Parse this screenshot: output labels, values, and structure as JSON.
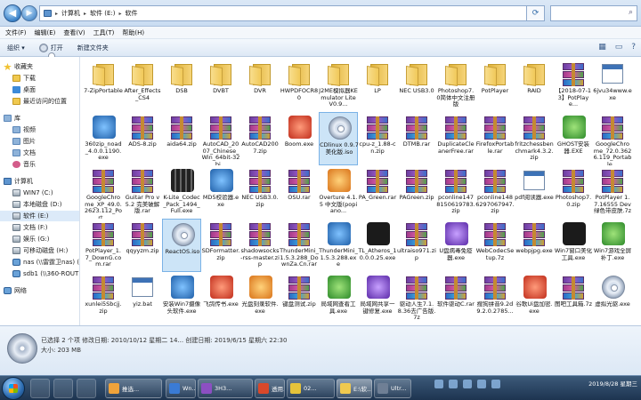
{
  "address": {
    "crumbs": [
      "计算机",
      "软件 (E:)",
      "软件"
    ],
    "separator": "▸"
  },
  "menubar": [
    "文件(F)",
    "编辑(E)",
    "查看(V)",
    "工具(T)",
    "帮助(H)"
  ],
  "toolbar": {
    "organize": "组织 ▾",
    "open": "打开",
    "new_folder": "新建文件夹"
  },
  "nav": [
    {
      "label": "收藏夹",
      "icon": "star-icon",
      "indent": 0
    },
    {
      "label": "下载",
      "icon": "folder-icon",
      "indent": 1
    },
    {
      "label": "桌面",
      "icon": "desktop-icon",
      "indent": 1
    },
    {
      "label": "最近访问的位置",
      "icon": "recent-icon",
      "indent": 1
    },
    {
      "label": "库",
      "icon": "library-icon",
      "indent": 0
    },
    {
      "label": "视频",
      "icon": "video-icon",
      "indent": 1
    },
    {
      "label": "图片",
      "icon": "pictures-icon",
      "indent": 1
    },
    {
      "label": "文档",
      "icon": "documents-icon",
      "indent": 1
    },
    {
      "label": "音乐",
      "icon": "music-icon",
      "indent": 1
    },
    {
      "label": "计算机",
      "icon": "computer-icon",
      "indent": 0
    },
    {
      "label": "WIN7 (C:)",
      "icon": "drive-icon",
      "indent": 1
    },
    {
      "label": "本地磁盘 (D:)",
      "icon": "drive-icon",
      "indent": 1
    },
    {
      "label": "软件 (E:)",
      "icon": "drive-icon",
      "indent": 1,
      "selected": true
    },
    {
      "label": "文档 (F:)",
      "icon": "drive-icon",
      "indent": 1
    },
    {
      "label": "娱乐 (G:)",
      "icon": "drive-icon",
      "indent": 1
    },
    {
      "label": "可移动磁盘 (H:)",
      "icon": "drive-icon",
      "indent": 1
    },
    {
      "label": "nas (\\\\雷霆卫nas) (Y:",
      "icon": "network-drive-icon",
      "indent": 1
    },
    {
      "label": "sdb1 (\\\\360-ROUT",
      "icon": "network-drive-icon",
      "indent": 1
    },
    {
      "label": "网络",
      "icon": "network-icon",
      "indent": 0
    }
  ],
  "files": [
    {
      "name": "7-ZipPortable",
      "type": "folder"
    },
    {
      "name": "After_Effects_CS4",
      "type": "folder"
    },
    {
      "name": "DSB",
      "type": "folder"
    },
    {
      "name": "DVBT",
      "type": "folder"
    },
    {
      "name": "DVR",
      "type": "folder"
    },
    {
      "name": "HWPDFOCR80",
      "type": "folder"
    },
    {
      "name": "J2ME模拟器KEmulator Lite V0.9...",
      "type": "folder"
    },
    {
      "name": "LP",
      "type": "folder"
    },
    {
      "name": "NEC USB3.0",
      "type": "folder"
    },
    {
      "name": "Photoshop7.0简体中文注册版",
      "type": "folder"
    },
    {
      "name": "PotPlayer",
      "type": "folder"
    },
    {
      "name": "RAID",
      "type": "folder"
    },
    {
      "name": "【2018-07-13】PotPlaye...",
      "type": "rar"
    },
    {
      "name": "6jvu34www.exe",
      "type": "exe"
    },
    {
      "name": "360zip_noad_4.0.0.1190.exe",
      "type": "app-blue"
    },
    {
      "name": "ADS-8.zip",
      "type": "rar"
    },
    {
      "name": "aida64.zip",
      "type": "rar"
    },
    {
      "name": "AutoCAD_2007_Chinese_Win_64bit-32bi...",
      "type": "rar"
    },
    {
      "name": "AutoCAD2007.zip",
      "type": "rar"
    },
    {
      "name": "Boom.exe",
      "type": "app-red"
    },
    {
      "name": "CDlinux 0.9.7 美化版.iso",
      "type": "iso",
      "selected": true
    },
    {
      "name": "cpu-z_1.88-cn.zip",
      "type": "rar"
    },
    {
      "name": "DTMB.rar",
      "type": "rar"
    },
    {
      "name": "DuplicateCleanerFree.rar",
      "type": "rar"
    },
    {
      "name": "FirefoxPortable.rar",
      "type": "rar"
    },
    {
      "name": "fritzchessbenchmark4.3.2.zip",
      "type": "rar"
    },
    {
      "name": "GHOST安装器.EXE",
      "type": "app-green"
    },
    {
      "name": "GoogleChrome_72.0.3626.119_Portable...",
      "type": "rar"
    },
    {
      "name": "GoogleChrome_XP_49.0.2623.112_Port...",
      "type": "rar"
    },
    {
      "name": "Guitar Pro v5.2 完美破解版.rar",
      "type": "rar"
    },
    {
      "name": "K-Lite_Codec_Pack_1494_Full.exe",
      "type": "app-film"
    },
    {
      "name": "MD5校验器.exe",
      "type": "app-blue"
    },
    {
      "name": "NEC USB3.0.zip",
      "type": "rar"
    },
    {
      "name": "OSU.rar",
      "type": "rar"
    },
    {
      "name": "Overture 4.1.5 中文版(popiano...",
      "type": "app-orange"
    },
    {
      "name": "PA_Green.rar",
      "type": "rar"
    },
    {
      "name": "PAGreen.zip",
      "type": "rar"
    },
    {
      "name": "pconline1478150619783.zip",
      "type": "rar"
    },
    {
      "name": "pconline1486297067947.zip",
      "type": "rar"
    },
    {
      "name": "pdf阅读器.exe",
      "type": "exe"
    },
    {
      "name": "Photoshop7.0.zip",
      "type": "rar"
    },
    {
      "name": "PotPlayer 1.7.16555 Dev 绿色带皮肤.7z",
      "type": "rar"
    },
    {
      "name": "PotPlayer_1.7_DownG.com.rar",
      "type": "rar"
    },
    {
      "name": "qqyyzm.zip",
      "type": "rar"
    },
    {
      "name": "ReactOS.iso",
      "type": "iso",
      "selected": true
    },
    {
      "name": "SDFormatter.zip",
      "type": "rar"
    },
    {
      "name": "shadowsocks-rss-master.zip",
      "type": "rar"
    },
    {
      "name": "ThunderMini_1.5.3.288_DownZa.Cn.rar",
      "type": "rar"
    },
    {
      "name": "ThunderMini_1.5.3.288.exe",
      "type": "app-blue"
    },
    {
      "name": "TL_Atheros_10.0.0.25.exe",
      "type": "app-dark"
    },
    {
      "name": "ultraiso971.zip",
      "type": "rar"
    },
    {
      "name": "U盘病毒免疫器.exe",
      "type": "app-purple"
    },
    {
      "name": "WebCodecSetup.7z",
      "type": "rar"
    },
    {
      "name": "webpjpg.exe",
      "type": "rar"
    },
    {
      "name": "Win7窗口美化工具.exe",
      "type": "app-dark"
    },
    {
      "name": "Win7游戏全屏补丁.exe",
      "type": "app-green"
    },
    {
      "name": "xunlei5Sbcjj.zip",
      "type": "rar"
    },
    {
      "name": "yiz.bat",
      "type": "exe"
    },
    {
      "name": "安装Win7摄像头软件.exe",
      "type": "app-blue"
    },
    {
      "name": "飞鸽传书.exe",
      "type": "app-red"
    },
    {
      "name": "光盘刻录软件.exe",
      "type": "app-orange"
    },
    {
      "name": "键盘测试.zip",
      "type": "rar"
    },
    {
      "name": "局域网查看工具.exe",
      "type": "app-green"
    },
    {
      "name": "局域网共享一键修复.exe",
      "type": "app-purple"
    },
    {
      "name": "驱动人生7.1.8.36去广告版.7z",
      "type": "rar"
    },
    {
      "name": "软件驱动C.rar",
      "type": "rar"
    },
    {
      "name": "搜狗拼音9.2d9.2.0.2785...",
      "type": "rar"
    },
    {
      "name": "谷歌Ui盘加密.exe",
      "type": "app-red"
    },
    {
      "name": "图吧工具箱.7z",
      "type": "rar"
    },
    {
      "name": "虚拟光驱.exe",
      "type": "iso"
    }
  ],
  "details": {
    "line1": "已选择 2 个项   修改日期: 2010/10/12 星期二 14...   创建日期: 2019/6/15 星期六 22:30",
    "line2": "大小: 203 MB"
  },
  "taskbar": {
    "tasks": [
      {
        "label": "推选...",
        "color": "#f0a33a"
      },
      {
        "label": "Wn...",
        "color": "#3a7bd5"
      },
      {
        "label": "3H3...",
        "color": "#8c4fc2"
      },
      {
        "label": "透用...",
        "color": "#d9482a"
      },
      {
        "label": "02...",
        "color": "#e5c33a"
      },
      {
        "label": "E:\\软...",
        "color": "#f0c94f",
        "active": true
      },
      {
        "label": "Ultr...",
        "color": "#6f7f95"
      }
    ],
    "clock_time": "",
    "clock_date": "2019/8/28 星期三"
  }
}
